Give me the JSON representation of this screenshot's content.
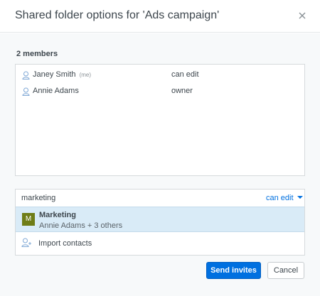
{
  "dialog": {
    "title": "Shared folder options for 'Ads campaign'",
    "close_icon": "close-icon"
  },
  "members": {
    "count_label": "2 members",
    "items": [
      {
        "name": "Janey Smith",
        "tag": "(me)",
        "role": "can edit",
        "icon": "user-icon"
      },
      {
        "name": "Annie Adams",
        "tag": "",
        "role": "owner",
        "icon": "user-icon"
      }
    ]
  },
  "invite": {
    "input_value": "marketing",
    "permission": "can edit",
    "suggestion": {
      "badge": "M",
      "name": "Marketing",
      "subtitle": "Annie Adams + 3 others",
      "badge_color": "#6f7d17"
    },
    "import_label": "Import contacts",
    "import_icon": "add-contact-icon"
  },
  "actions": {
    "send_label": "Send invites",
    "cancel_label": "Cancel"
  },
  "colors": {
    "accent": "#0070e0",
    "highlight": "#d9ebf7"
  }
}
